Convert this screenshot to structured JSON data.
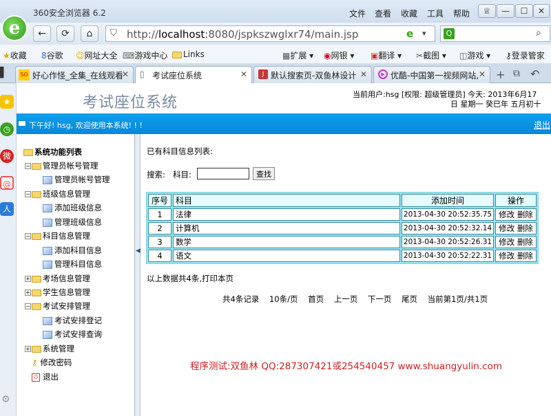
{
  "browser": {
    "title": "360安全浏览器 6.2",
    "menus": [
      "文件",
      "查看",
      "收藏",
      "工具",
      "帮助"
    ],
    "url_host": "localhost",
    "url_prefix": "http://",
    "url_rest": ":8080/jspkszwglxr74/main.jsp"
  },
  "bookmarks": [
    "收藏",
    "谷歌",
    "网址大全",
    "游戏中心",
    "Links",
    "扩展",
    "网银",
    "翻译",
    "截图",
    "游戏",
    "登录管家"
  ],
  "tabs": [
    "好心作怪_全集_在线观看",
    "考试座位系统",
    "默认搜索页-双鱼林设计",
    "优酷-中国第一视频网站,"
  ],
  "header": {
    "system_title": "考试座位系统",
    "user_info": "当前用户:hsg [权限: 超级管理员] 今天: 2013年6月17",
    "date_info": "日 星期一 癸巳年 五月初十",
    "welcome": "下午好! hsg, 欢迎使用本系统! ! !",
    "logout": "退出"
  },
  "tree": {
    "root": "系统功能列表",
    "nodes": [
      "管理员帐号管理",
      "管理员帐号管理",
      "班级信息管理",
      "添加班级信息",
      "管理班级信息",
      "科目信息管理",
      "添加科目信息",
      "管理科目信息",
      "考场信息管理",
      "学生信息管理",
      "考试安排管理",
      "考试安排登记",
      "考试安排查询",
      "系统管理",
      "修改密码",
      "退出"
    ]
  },
  "main": {
    "list_title": "已有科目信息列表:",
    "search_label": "搜索:",
    "subject_label": "科目:",
    "search_button": "查找",
    "columns": [
      "序号",
      "科目",
      "添加时间",
      "操作"
    ],
    "rows": [
      {
        "no": "1",
        "subject": "法律",
        "time": "2013-04-30 20:52:35.75"
      },
      {
        "no": "2",
        "subject": "计算机",
        "time": "2013-04-30 20:52:32.14"
      },
      {
        "no": "3",
        "subject": "数学",
        "time": "2013-04-30 20:52:26.31"
      },
      {
        "no": "4",
        "subject": "语文",
        "time": "2013-04-30 20:52:22.31"
      }
    ],
    "edit_label": "修改",
    "delete_label": "删除",
    "summary": "以上数据共4条,",
    "print_label": "打印本页",
    "pagination": {
      "total": "共4条记录",
      "per_page": "10条/页",
      "first": "首页",
      "prev": "上一页",
      "next": "下一页",
      "last": "尾页",
      "current": "当前第1页/共1页"
    }
  },
  "credit": "程序测试:双鱼林 QQ:287307421或254540457 www.shuangyulin.com"
}
